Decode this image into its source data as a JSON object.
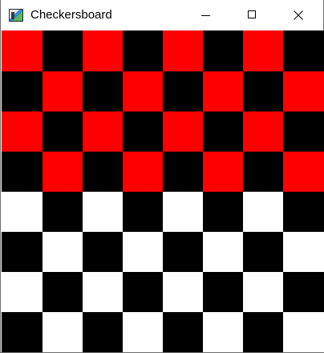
{
  "window": {
    "title": "Checkersboard",
    "icon": "app-window-icon",
    "buttons": {
      "minimize": "minimize-icon",
      "maximize": "maximize-icon",
      "close": "close-icon"
    }
  },
  "board": {
    "rows": 8,
    "cols": 8,
    "colors": {
      "red": "#ff0000",
      "black": "#000000",
      "white": "#ffffff"
    },
    "cells": [
      [
        "red",
        "black",
        "red",
        "black",
        "red",
        "black",
        "red",
        "black"
      ],
      [
        "black",
        "red",
        "black",
        "red",
        "black",
        "red",
        "black",
        "red"
      ],
      [
        "red",
        "black",
        "red",
        "black",
        "red",
        "black",
        "red",
        "black"
      ],
      [
        "black",
        "red",
        "black",
        "red",
        "black",
        "red",
        "black",
        "red"
      ],
      [
        "white",
        "black",
        "white",
        "black",
        "white",
        "black",
        "white",
        "black"
      ],
      [
        "black",
        "white",
        "black",
        "white",
        "black",
        "white",
        "black",
        "white"
      ],
      [
        "white",
        "black",
        "white",
        "black",
        "white",
        "black",
        "white",
        "black"
      ],
      [
        "black",
        "white",
        "black",
        "white",
        "black",
        "white",
        "black",
        "white"
      ]
    ]
  }
}
